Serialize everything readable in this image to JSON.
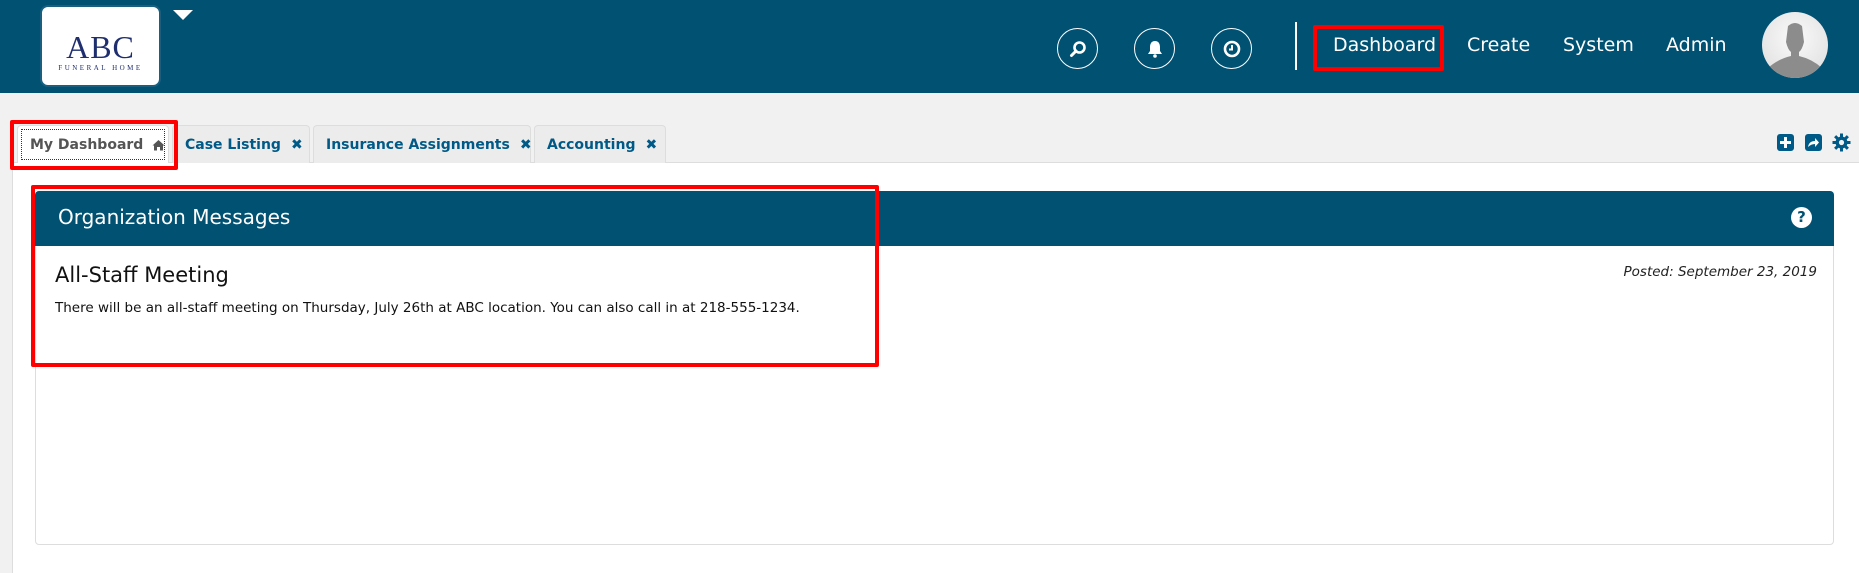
{
  "header": {
    "logo": {
      "title": "ABC",
      "subtitle": "FUNERAL HOME"
    },
    "icons": [
      "search-icon",
      "bell-icon",
      "clock-icon"
    ],
    "nav": [
      {
        "label": "Dashboard",
        "highlighted": true
      },
      {
        "label": "Create"
      },
      {
        "label": "System"
      },
      {
        "label": "Admin"
      }
    ]
  },
  "tabs": [
    {
      "label": "My Dashboard",
      "icon": "home-icon",
      "active": true
    },
    {
      "label": "Case Listing",
      "icon": "close-icon"
    },
    {
      "label": "Insurance Assignments",
      "icon": "close-icon"
    },
    {
      "label": "Accounting",
      "icon": "close-icon"
    }
  ],
  "tab_tools": [
    "add-widget-icon",
    "share-icon",
    "gear-icon"
  ],
  "panel": {
    "title": "Organization Messages",
    "help": "?",
    "message": {
      "title": "All-Staff Meeting",
      "posted": "Posted: September 23, 2019",
      "body": "There will be an all-staff meeting on Thursday, July 26th at ABC location. You can also call in at 218-555-1234."
    }
  },
  "colors": {
    "brand": "#005172",
    "highlight": "#ff0000",
    "tab_text": "#005a87"
  }
}
